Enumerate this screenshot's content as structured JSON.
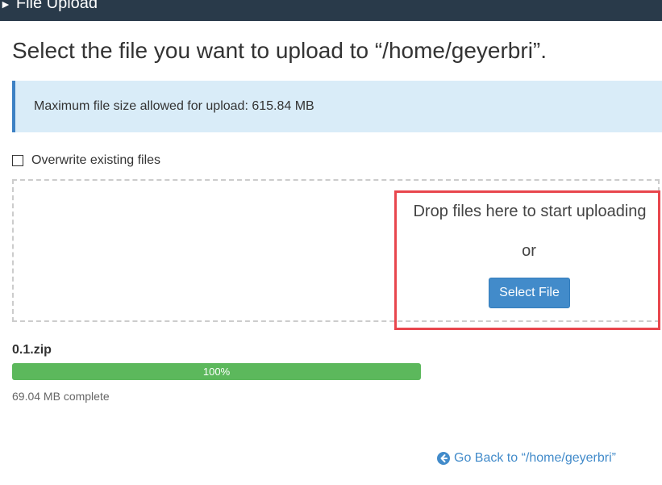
{
  "header": {
    "title": "File Upload"
  },
  "page": {
    "title": "Select the file you want to upload to “/home/geyerbri”."
  },
  "info": {
    "max_size_text": "Maximum file size allowed for upload: 615.84 MB"
  },
  "overwrite": {
    "label": "Overwrite existing files",
    "checked": false
  },
  "dropzone": {
    "drop_text": "Drop files here to start uploading",
    "or_text": "or",
    "select_button_label": "Select File"
  },
  "upload": {
    "file_name": "0.1.zip",
    "progress_label": "100%",
    "progress_fraction": 1.0,
    "status_text": "69.04 MB complete"
  },
  "footer": {
    "go_back_label": "Go Back to “/home/geyerbri”"
  },
  "colors": {
    "header_bg": "#293a4a",
    "info_bg": "#d9ecf8",
    "info_accent": "#3d81c4",
    "primary_button": "#428bca",
    "progress_success": "#5cb85c",
    "highlight_border": "#e8464d",
    "link": "#428bca"
  },
  "icons": {
    "header": "chevron-icon",
    "go_back": "arrow-circle-left-icon"
  }
}
